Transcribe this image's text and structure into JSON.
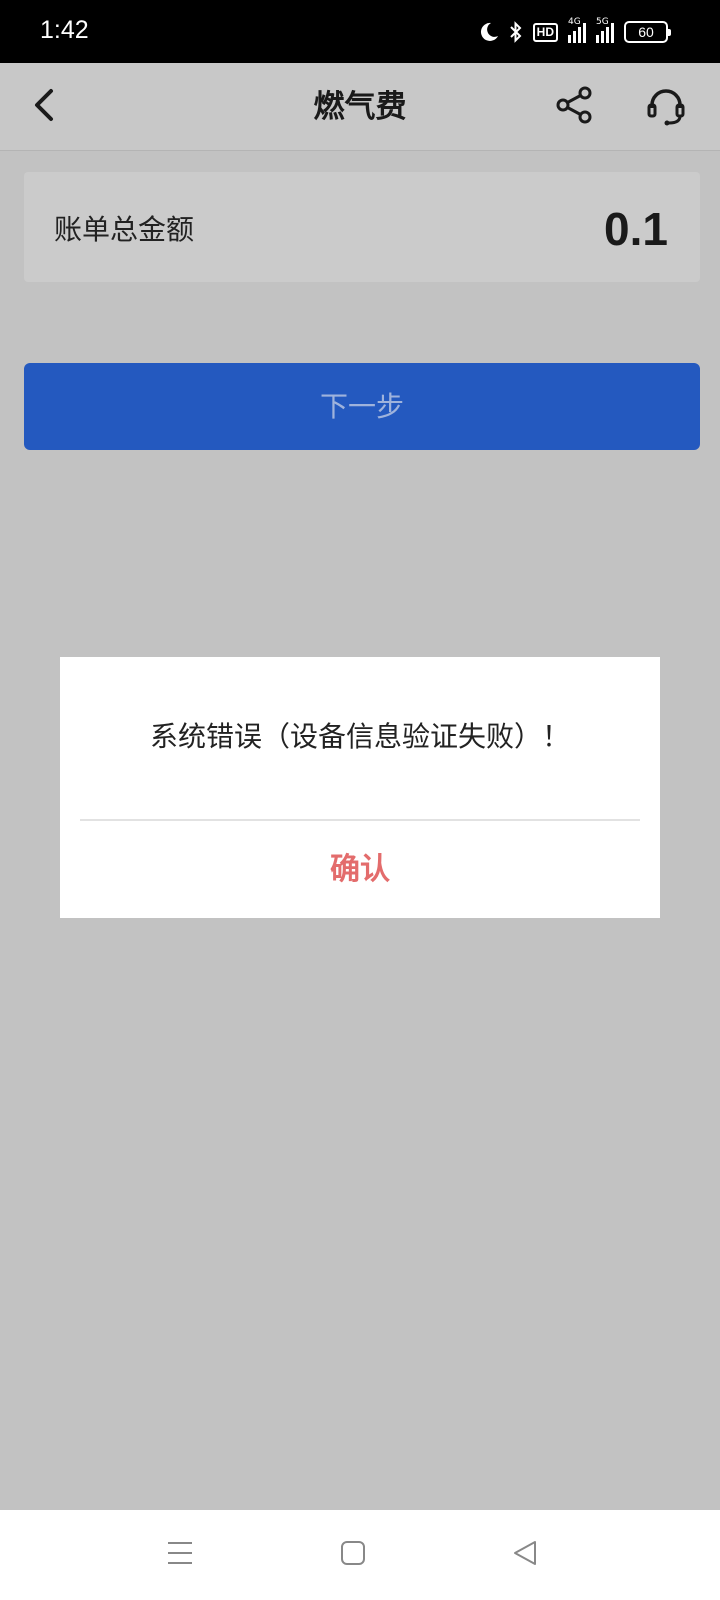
{
  "status_bar": {
    "time": "1:42",
    "hd_label": "HD",
    "net1_label": "4G",
    "net2_label": "5G",
    "battery": "60",
    "icons": [
      "moon-icon",
      "bluetooth-icon",
      "hd-icon",
      "signal-4g-icon",
      "signal-5g-icon",
      "battery-icon"
    ]
  },
  "app_bar": {
    "title": "燃气费",
    "icons": [
      "back-icon",
      "share-icon",
      "headset-icon"
    ]
  },
  "bill": {
    "label": "账单总金额",
    "amount": "0.1"
  },
  "next_button": {
    "label": "下一步",
    "color": "#2459bf"
  },
  "dialog": {
    "message": "系统错误（设备信息验证失败）！",
    "confirm_label": "确认",
    "confirm_color": "#e36c6c"
  },
  "nav_bar": {
    "icons": [
      "menu-icon",
      "home-icon",
      "back-triangle-icon"
    ]
  }
}
